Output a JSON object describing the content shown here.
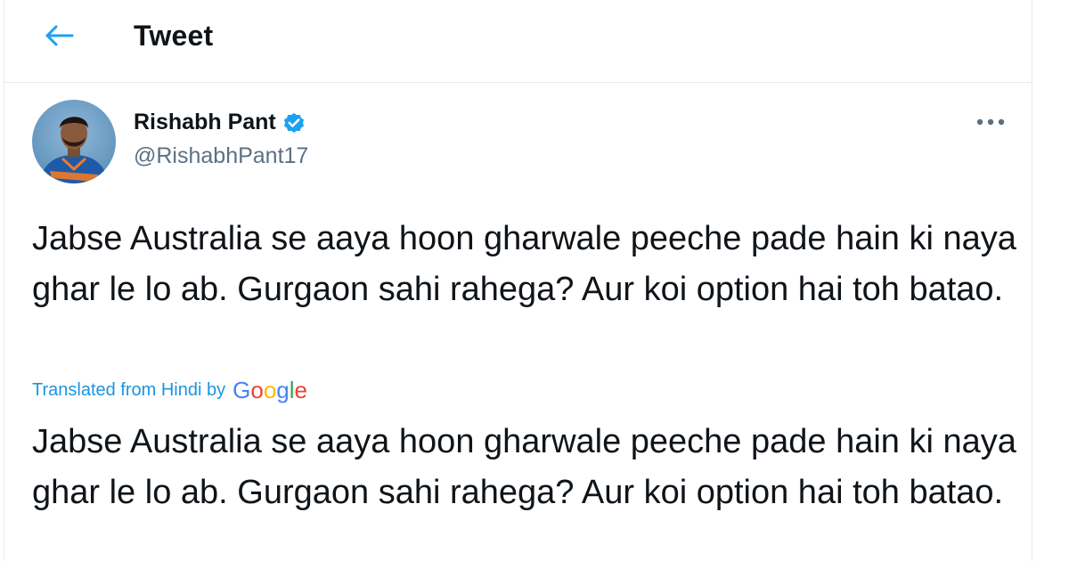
{
  "header": {
    "title": "Tweet",
    "back_icon": "arrow-left-icon"
  },
  "tweet": {
    "author": {
      "display_name": "Rishabh Pant",
      "handle": "@RishabhPant17",
      "verified": true
    },
    "more_icon": "more-horizontal-icon",
    "text": "Jabse Australia se aaya hoon gharwale peeche pade hain ki naya ghar le lo ab. Gurgaon sahi rahega? Aur koi option hai toh batao.",
    "translation": {
      "label": "Translated from Hindi by",
      "provider": "Google",
      "text": "Jabse Australia se aaya hoon gharwale peeche pade hain ki naya ghar le lo ab. Gurgaon sahi rahega? Aur koi option hai toh batao."
    }
  },
  "colors": {
    "accent": "#1da1f2",
    "translation_link": "#1b95e0",
    "secondary_text": "#5b7083",
    "border": "#e6ecf0",
    "google_blue": "#4285f4",
    "google_red": "#ea4335",
    "google_yellow": "#fbbc05",
    "google_green": "#34a853"
  }
}
